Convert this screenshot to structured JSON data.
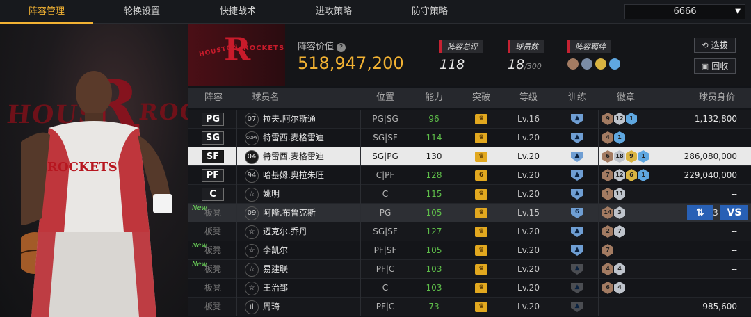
{
  "nav": {
    "tabs": [
      "阵容管理",
      "轮换设置",
      "快捷战术",
      "进攻策略",
      "防守策略"
    ],
    "active_index": 0,
    "dropdown_value": "6666"
  },
  "hero": {
    "bg_text": "HOUS",
    "bg_text2": "ROCK",
    "jersey": "ROCKETS"
  },
  "team": {
    "logo_top": "HOUSTON",
    "logo_right": "ROCKETS",
    "value_label": "阵容价值",
    "value": "518,947,200",
    "total_label": "阵容总评",
    "total": "118",
    "players_label": "球员数",
    "players": "18",
    "players_max": "/300",
    "chem_label": "阵容羁绊",
    "chem_colors": [
      "#a37b62",
      "#7b8ca5",
      "#d9b441",
      "#5fa7e0"
    ],
    "btn_select": "选拔",
    "btn_recycle": "回收"
  },
  "table": {
    "headers": [
      "阵容",
      "球员名",
      "位置",
      "能力",
      "突破",
      "等级",
      "训练",
      "徽章",
      "球员身价"
    ],
    "rows": [
      {
        "slot": "PG",
        "new": "",
        "num": "07",
        "name": "拉夫.阿尔斯通",
        "pos": "PG|SG",
        "ability": "96",
        "green": true,
        "break": "crown",
        "level": "Lv.16",
        "train": "shield",
        "train_num": "",
        "badges": [
          [
            "br",
            "9"
          ],
          [
            "sv",
            "12"
          ],
          [
            "bl",
            "1"
          ]
        ],
        "price": "1,132,800"
      },
      {
        "slot": "SG",
        "new": "",
        "num": "COPY",
        "name": "特雷西.麦格雷迪",
        "pos": "SG|SF",
        "ability": "114",
        "green": true,
        "break": "crown",
        "level": "Lv.20",
        "train": "shield",
        "train_num": "",
        "badges": [
          [
            "br",
            "4"
          ],
          [
            "bl",
            "1"
          ]
        ],
        "price": "--"
      },
      {
        "slot": "SF",
        "new": "",
        "num": "04",
        "name": "特雷西.麦格雷迪",
        "pos": "SG|PG",
        "ability": "130",
        "green": false,
        "break": "crown",
        "level": "Lv.20",
        "train": "shield",
        "train_num": "",
        "badges": [
          [
            "br",
            "6"
          ],
          [
            "sv",
            "18"
          ],
          [
            "gd",
            "9"
          ],
          [
            "bl",
            "1"
          ]
        ],
        "price": "286,080,000"
      },
      {
        "slot": "PF",
        "new": "",
        "num": "94",
        "name": "哈基姆.奥拉朱旺",
        "pos": "C|PF",
        "ability": "128",
        "green": true,
        "break": "crown6",
        "level": "Lv.20",
        "train": "shield",
        "train_num": "",
        "badges": [
          [
            "br",
            "7"
          ],
          [
            "sv",
            "12"
          ],
          [
            "gd",
            "6"
          ],
          [
            "bl",
            "1"
          ]
        ],
        "price": "229,040,000"
      },
      {
        "slot": "C",
        "new": "",
        "num": "☆",
        "name": "姚明",
        "pos": "C",
        "ability": "115",
        "green": true,
        "break": "crown",
        "level": "Lv.20",
        "train": "shield",
        "train_num": "",
        "badges": [
          [
            "br",
            "1"
          ],
          [
            "sv",
            "11"
          ]
        ],
        "price": "--"
      },
      {
        "slot": "板凳",
        "new": "New",
        "num": "09",
        "name": "阿隆.布鲁克斯",
        "pos": "PG",
        "ability": "105",
        "green": true,
        "break": "crown",
        "level": "Lv.15",
        "train": "shield",
        "train_num": "6",
        "badges": [
          [
            "br",
            "14"
          ],
          [
            "sv",
            "3"
          ]
        ],
        "price": "3"
      },
      {
        "slot": "板凳",
        "new": "",
        "num": "☆",
        "name": "迈克尔.乔丹",
        "pos": "SG|SF",
        "ability": "127",
        "green": true,
        "break": "crown",
        "level": "Lv.20",
        "train": "shield",
        "train_num": "",
        "badges": [
          [
            "br",
            "2"
          ],
          [
            "sv",
            "7"
          ]
        ],
        "price": "--"
      },
      {
        "slot": "板凳",
        "new": "New",
        "num": "☆",
        "name": "李凯尔",
        "pos": "PF|SF",
        "ability": "105",
        "green": true,
        "break": "crown",
        "level": "Lv.20",
        "train": "shield",
        "train_num": "",
        "badges": [
          [
            "br",
            "7"
          ]
        ],
        "price": "--"
      },
      {
        "slot": "板凳",
        "new": "New",
        "num": "☆",
        "name": "易建联",
        "pos": "PF|C",
        "ability": "103",
        "green": true,
        "break": "crown",
        "level": "Lv.20",
        "train": "grey",
        "train_num": "",
        "badges": [
          [
            "br",
            "4"
          ],
          [
            "sv",
            "4"
          ]
        ],
        "price": "--"
      },
      {
        "slot": "板凳",
        "new": "",
        "num": "☆",
        "name": "王治郅",
        "pos": "C",
        "ability": "103",
        "green": true,
        "break": "crown",
        "level": "Lv.20",
        "train": "grey",
        "train_num": "",
        "badges": [
          [
            "br",
            "6"
          ],
          [
            "sv",
            "4"
          ]
        ],
        "price": "--"
      },
      {
        "slot": "板凳",
        "new": "",
        "num": "ıl",
        "name": "周琦",
        "pos": "PF|C",
        "ability": "73",
        "green": true,
        "break": "crown",
        "level": "Lv.20",
        "train": "grey",
        "train_num": "",
        "badges": [],
        "price": "985,600"
      }
    ],
    "swap_label": "⇅",
    "vs_label": "VS"
  }
}
